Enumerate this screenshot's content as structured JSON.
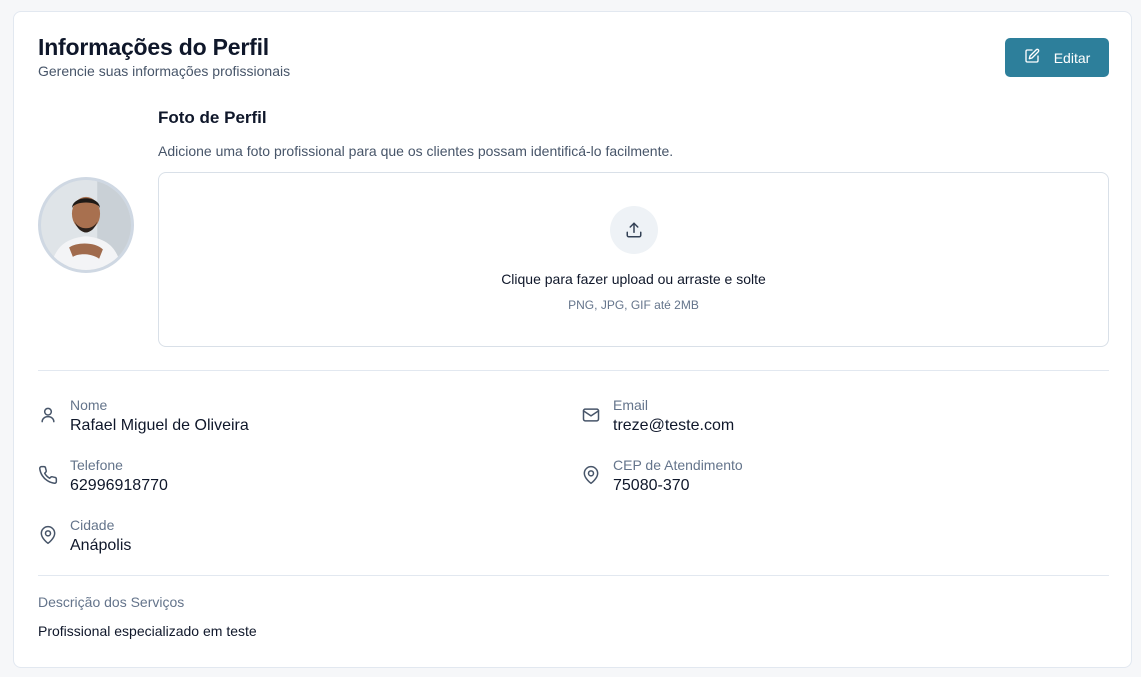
{
  "header": {
    "title": "Informações do Perfil",
    "subtitle": "Gerencie suas informações profissionais",
    "edit_label": "Editar",
    "edit_icon": "edit-icon"
  },
  "photo": {
    "title": "Foto de Perfil",
    "description": "Adicione uma foto profissional para que os clientes possam identificá-lo facilmente.",
    "upload_title": "Clique para fazer upload ou arraste e solte",
    "upload_hint": "PNG, JPG, GIF até 2MB",
    "upload_icon": "upload-icon"
  },
  "fields": {
    "name": {
      "label": "Nome",
      "value": "Rafael Miguel de Oliveira",
      "icon": "user-icon"
    },
    "email": {
      "label": "Email",
      "value": "treze@teste.com",
      "icon": "mail-icon"
    },
    "phone": {
      "label": "Telefone",
      "value": "62996918770",
      "icon": "phone-icon"
    },
    "cep": {
      "label": "CEP de Atendimento",
      "value": "75080-370",
      "icon": "map-pin-icon"
    },
    "city": {
      "label": "Cidade",
      "value": "Anápolis",
      "icon": "map-pin-icon"
    }
  },
  "services": {
    "label": "Descrição dos Serviços",
    "value": "Profissional especializado em teste"
  },
  "colors": {
    "accent": "#2d7f9b",
    "background": "#f6f7f9",
    "card": "#ffffff",
    "border": "#e2e8f0",
    "muted_text": "#64748b"
  }
}
